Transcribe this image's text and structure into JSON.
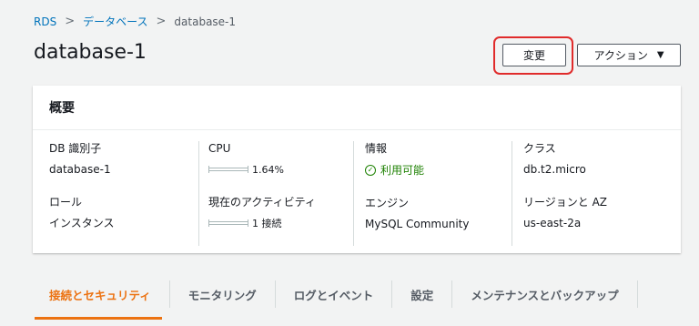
{
  "breadcrumb": {
    "items": [
      "RDS",
      "データベース"
    ],
    "separator": ">",
    "current": "database-1"
  },
  "title": "database-1",
  "header_buttons": {
    "modify": "変更",
    "actions": "アクション",
    "actions_caret": "▼"
  },
  "summary": {
    "title": "概要",
    "db_identifier": {
      "label": "DB 識別子",
      "value": "database-1"
    },
    "role": {
      "label": "ロール",
      "value": "インスタンス"
    },
    "cpu": {
      "label": "CPU",
      "value": "1.64%",
      "fraction": 0.0164
    },
    "activity": {
      "label": "現在のアクティビティ",
      "value": "1 接続"
    },
    "info": {
      "label": "情報",
      "status": "利用可能",
      "status_icon": "check-circle-icon"
    },
    "engine": {
      "label": "エンジン",
      "value": "MySQL Community"
    },
    "class": {
      "label": "クラス",
      "value": "db.t2.micro"
    },
    "region": {
      "label": "リージョンと AZ",
      "value": "us-east-2a"
    }
  },
  "tabs": [
    {
      "label": "接続とセキュリティ",
      "active": true
    },
    {
      "label": "モニタリング",
      "active": false
    },
    {
      "label": "ログとイベント",
      "active": false
    },
    {
      "label": "設定",
      "active": false
    },
    {
      "label": "メンテナンスとバックアップ",
      "active": false
    }
  ],
  "colors": {
    "link": "#0073bb",
    "accent": "#ec7211",
    "success": "#1d8102",
    "highlight": "#e02b2b"
  }
}
